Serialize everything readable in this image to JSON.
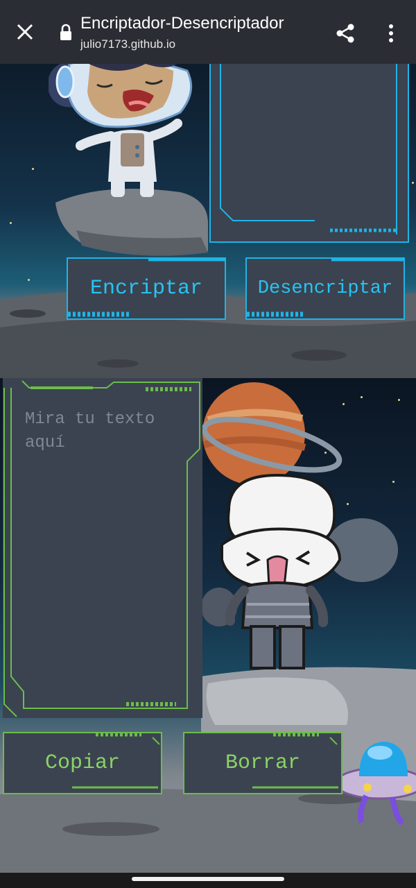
{
  "browser": {
    "title": "Encriptador-Desencriptador",
    "url": "julio7173.github.io",
    "close_icon": "close-icon",
    "lock_icon": "lock-icon",
    "share_icon": "share-icon",
    "more_icon": "more-vert-icon"
  },
  "actions": {
    "encrypt_label": "Encriptar",
    "decrypt_label": "Desencriptar",
    "copy_label": "Copiar",
    "clear_label": "Borrar"
  },
  "output": {
    "placeholder": "Mira tu texto aquí",
    "value": ""
  },
  "colors": {
    "cyan_accent": "#1fb4e6",
    "green_accent": "#6cbd4b",
    "panel": "#3b4350",
    "browser_bar": "#2a2d33"
  }
}
